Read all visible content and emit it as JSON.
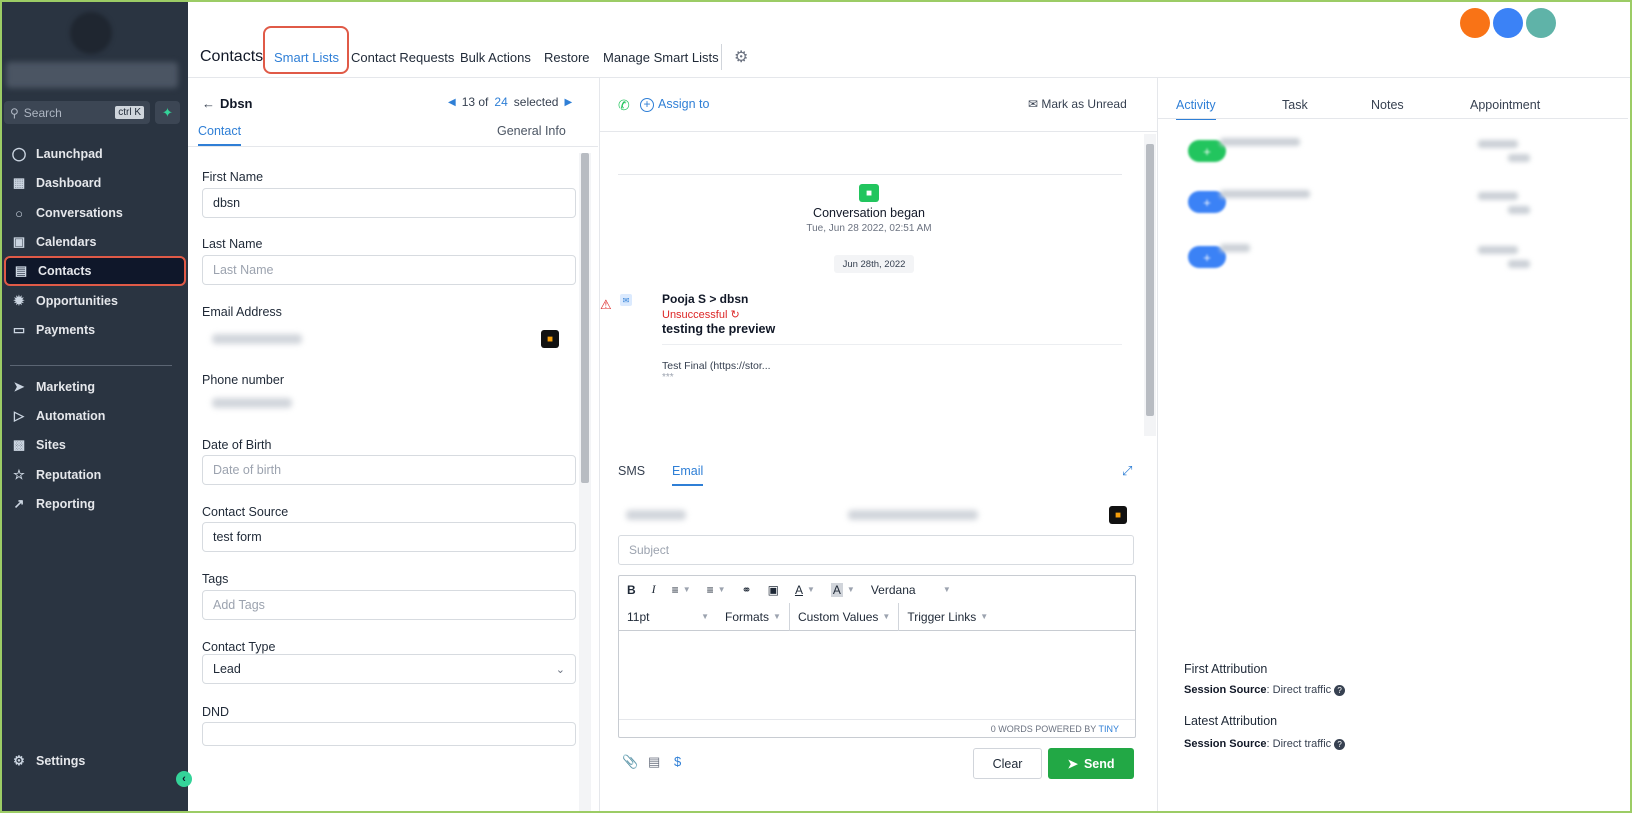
{
  "sidebar": {
    "search_placeholder": "Search",
    "search_shortcut": "ctrl K",
    "items": [
      {
        "label": "Launchpad",
        "icon": "launchpad-icon"
      },
      {
        "label": "Dashboard",
        "icon": "dashboard-icon"
      },
      {
        "label": "Conversations",
        "icon": "conversations-icon"
      },
      {
        "label": "Calendars",
        "icon": "calendar-icon"
      },
      {
        "label": "Contacts",
        "icon": "contacts-icon",
        "active": true
      },
      {
        "label": "Opportunities",
        "icon": "opportunities-icon"
      },
      {
        "label": "Payments",
        "icon": "payments-icon"
      },
      {
        "label": "Marketing",
        "icon": "marketing-icon"
      },
      {
        "label": "Automation",
        "icon": "automation-icon"
      },
      {
        "label": "Sites",
        "icon": "sites-icon"
      },
      {
        "label": "Reputation",
        "icon": "reputation-icon"
      },
      {
        "label": "Reporting",
        "icon": "reporting-icon"
      }
    ],
    "settings_label": "Settings"
  },
  "header": {
    "title": "Contacts",
    "tabs": [
      "Smart Lists",
      "Contact Requests",
      "Bulk Actions",
      "Restore",
      "Manage Smart Lists"
    ],
    "active_tab": "Smart Lists",
    "avatar_colors": [
      "#f97316",
      "#3b82f6",
      "#5fb3a8"
    ]
  },
  "contact_panel": {
    "back_label": "Dbsn",
    "position": "13 of",
    "total": "24",
    "selected_label": "selected",
    "tabs": [
      "Contact",
      "General Info"
    ],
    "fields": {
      "first_name_label": "First Name",
      "first_name_value": "dbsn",
      "last_name_label": "Last Name",
      "last_name_placeholder": "Last Name",
      "email_label": "Email Address",
      "phone_label": "Phone number",
      "dob_label": "Date of Birth",
      "dob_placeholder": "Date of birth",
      "source_label": "Contact Source",
      "source_value": "test form",
      "tags_label": "Tags",
      "tags_placeholder": "Add Tags",
      "type_label": "Contact Type",
      "type_value": "Lead",
      "dnd_label": "DND"
    }
  },
  "conversation": {
    "assign_label": "Assign to",
    "mark_unread_label": "Mark as Unread",
    "began_title": "Conversation began",
    "began_date": "Tue, Jun 28 2022, 02:51 AM",
    "date_pill": "Jun 28th, 2022",
    "message": {
      "from": "Pooja S > dbsn",
      "status": "Unsuccessful",
      "subject": "testing the preview",
      "body": "Test Final (https://stor...",
      "more": "***"
    },
    "composer": {
      "tabs": [
        "SMS",
        "Email"
      ],
      "active_tab": "Email",
      "subject_placeholder": "Subject",
      "font_name": "Verdana",
      "font_size": "11pt",
      "formats_label": "Formats",
      "custom_values_label": "Custom Values",
      "trigger_links_label": "Trigger Links",
      "footer_words": "0 WORDS POWERED BY",
      "footer_brand": "TINY",
      "clear_label": "Clear",
      "send_label": "Send"
    }
  },
  "activity": {
    "tabs": [
      "Activity",
      "Task",
      "Notes",
      "Appointment"
    ],
    "active_tab": "Activity",
    "first_attribution_title": "First Attribution",
    "latest_attribution_title": "Latest Attribution",
    "session_source_label": "Session Source",
    "first_source_value": "Direct traffic",
    "latest_source_value": "Direct traffic"
  }
}
